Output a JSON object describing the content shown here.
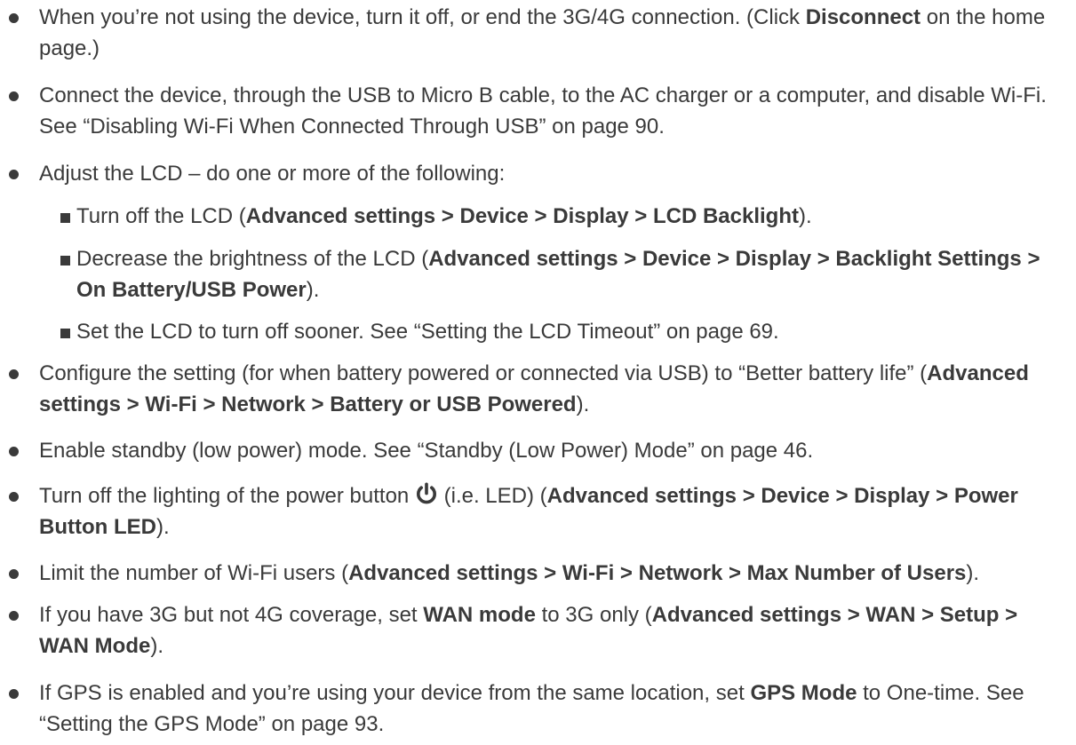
{
  "bullets": [
    {
      "parts": [
        {
          "t": "When you’re not using the device, turn it off, or end the 3G/4G connection. (Click "
        },
        {
          "t": "Disconnect",
          "b": true
        },
        {
          "t": " on the home page.)"
        }
      ]
    },
    {
      "parts": [
        {
          "t": "Connect the device, through the USB to Micro B cable, to the AC charger or a computer, and disable Wi-Fi. See “Disabling Wi-Fi When Connected Through USB” on page 90."
        }
      ]
    },
    {
      "parts": [
        {
          "t": "Adjust the LCD – do one or more of the following:"
        }
      ],
      "subitems": [
        {
          "parts": [
            {
              "t": "Turn off the LCD ("
            },
            {
              "t": "Advanced settings > Device > Display > LCD Backlight",
              "b": true
            },
            {
              "t": ")."
            }
          ]
        },
        {
          "parts": [
            {
              "t": "Decrease the brightness of the LCD ("
            },
            {
              "t": "Advanced settings > Device > Display > Backlight Settings > On Battery/USB Power",
              "b": true
            },
            {
              "t": ")."
            }
          ]
        },
        {
          "parts": [
            {
              "t": "Set the LCD to turn off sooner. See “Setting the LCD Timeout” on page 69."
            }
          ]
        }
      ]
    },
    {
      "parts": [
        {
          "t": "Configure the setting (for when battery powered or connected via USB) to “Better battery life” ("
        },
        {
          "t": "Advanced settings > Wi-Fi > Network > Battery or USB Powered",
          "b": true
        },
        {
          "t": ")."
        }
      ]
    },
    {
      "parts": [
        {
          "t": "Enable standby (low power) mode. See “Standby (Low Power) Mode” on page 46."
        }
      ]
    },
    {
      "parts": [
        {
          "t": "Turn off the lighting of the power button "
        },
        {
          "icon": "power-icon"
        },
        {
          "t": " (i.e. LED) ("
        },
        {
          "t": "Advanced settings > Device > Display > Power Button LED",
          "b": true
        },
        {
          "t": ")."
        }
      ]
    },
    {
      "parts": [
        {
          "t": "Limit the number of Wi-Fi users ("
        },
        {
          "t": "Advanced settings > Wi-Fi > Network > Max Number of Users",
          "b": true
        },
        {
          "t": ")."
        }
      ]
    },
    {
      "parts": [
        {
          "t": "If you have 3G but not 4G coverage, set "
        },
        {
          "t": "WAN mode",
          "b": true
        },
        {
          "t": " to 3G only ("
        },
        {
          "t": "Advanced settings > WAN > Setup > WAN Mode",
          "b": true
        },
        {
          "t": ")."
        }
      ]
    },
    {
      "parts": [
        {
          "t": "If GPS is enabled and you’re using your device from the same location, set "
        },
        {
          "t": "GPS Mode",
          "b": true
        },
        {
          "t": " to One-time. See “Setting the GPS Mode” on page 93."
        }
      ]
    }
  ]
}
